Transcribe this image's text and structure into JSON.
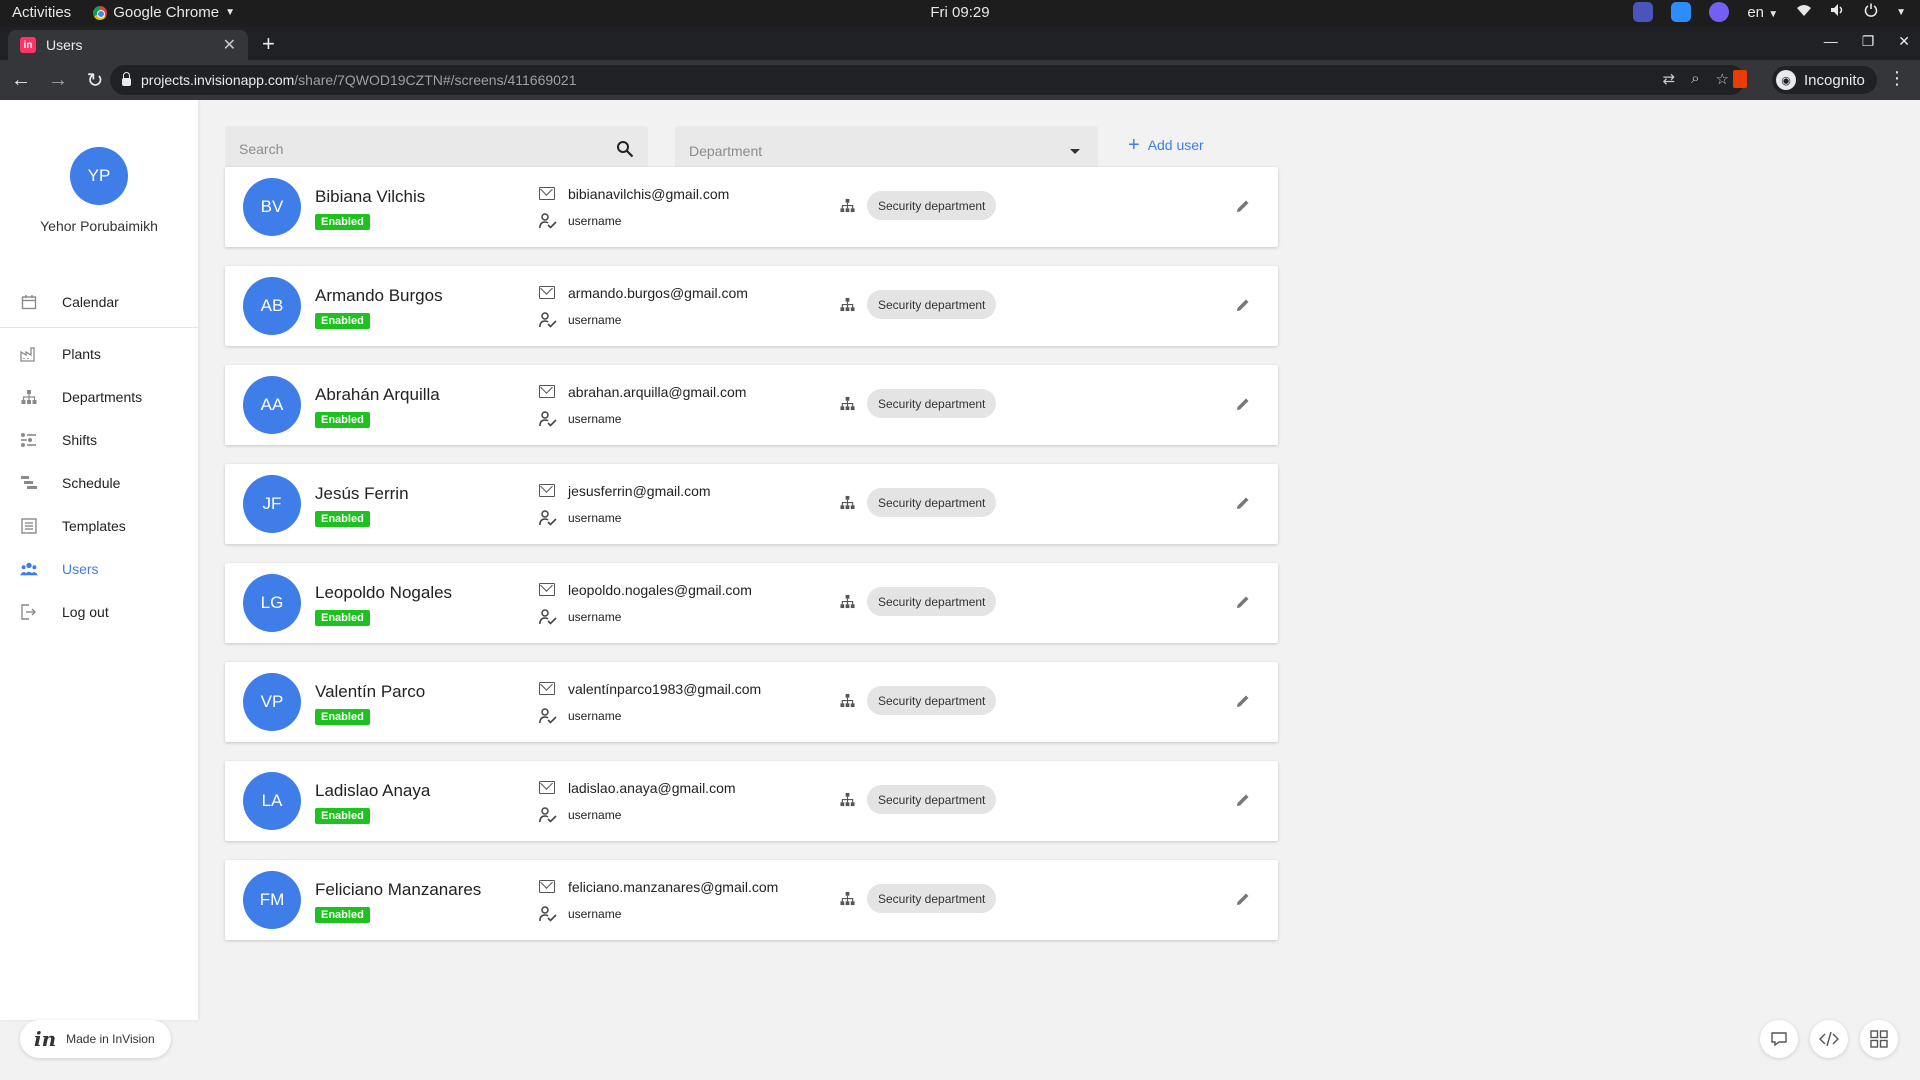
{
  "system": {
    "activities": "Activities",
    "app_name": "Google Chrome",
    "clock": "Fri 09:29",
    "lang": "en"
  },
  "browser": {
    "tab_title": "Users",
    "url_host": "projects.invisionapp.com",
    "url_path": "/share/7QWOD19CZTN#/screens/411669021",
    "profile": "Incognito"
  },
  "sidebar": {
    "user_initials": "YP",
    "user_name": "Yehor Porubaimikh",
    "items": [
      {
        "label": "Calendar",
        "icon": "calendar-icon"
      },
      {
        "label": "Plants",
        "icon": "factory-icon"
      },
      {
        "label": "Departments",
        "icon": "hierarchy-icon"
      },
      {
        "label": "Shifts",
        "icon": "shifts-icon"
      },
      {
        "label": "Schedule",
        "icon": "schedule-icon"
      },
      {
        "label": "Templates",
        "icon": "template-icon"
      },
      {
        "label": "Users",
        "icon": "users-icon"
      },
      {
        "label": "Log out",
        "icon": "logout-icon"
      }
    ],
    "active_item": "Users"
  },
  "filters": {
    "search_placeholder": "Search",
    "department_placeholder": "Department",
    "add_user_label": "Add user"
  },
  "users": [
    {
      "initials": "BV",
      "name": "Bibiana Vilchis",
      "status": "Enabled",
      "email": "bibianavilchis@gmail.com",
      "login": "username",
      "department": "Security department"
    },
    {
      "initials": "AB",
      "name": "Armando Burgos",
      "status": "Enabled",
      "email": "armando.burgos@gmail.com",
      "login": "username",
      "department": "Security department"
    },
    {
      "initials": "AA",
      "name": "Abrahán Arquilla",
      "status": "Enabled",
      "email": "abrahan.arquilla@gmail.com",
      "login": "username",
      "department": "Security department"
    },
    {
      "initials": "JF",
      "name": "Jesús Ferrin",
      "status": "Enabled",
      "email": "jesusferrin@gmail.com",
      "login": "username",
      "department": "Security department"
    },
    {
      "initials": "LG",
      "name": "Leopoldo Nogales",
      "status": "Enabled",
      "email": "leopoldo.nogales@gmail.com",
      "login": "username",
      "department": "Security department"
    },
    {
      "initials": "VP",
      "name": "Valentín Parco",
      "status": "Enabled",
      "email": "valentínparco1983@gmail.com",
      "login": "username",
      "department": "Security department"
    },
    {
      "initials": "LA",
      "name": "Ladislao Anaya",
      "status": "Enabled",
      "email": "ladislao.anaya@gmail.com",
      "login": "username",
      "department": "Security department"
    },
    {
      "initials": "FM",
      "name": "Feliciano Manzanares",
      "status": "Enabled",
      "email": "feliciano.manzanares@gmail.com",
      "login": "username",
      "department": "Security department"
    }
  ],
  "footer": {
    "made_in": "Made in InVision"
  },
  "colors": {
    "accent": "#3f7de8",
    "enabled": "#1ec21e"
  }
}
